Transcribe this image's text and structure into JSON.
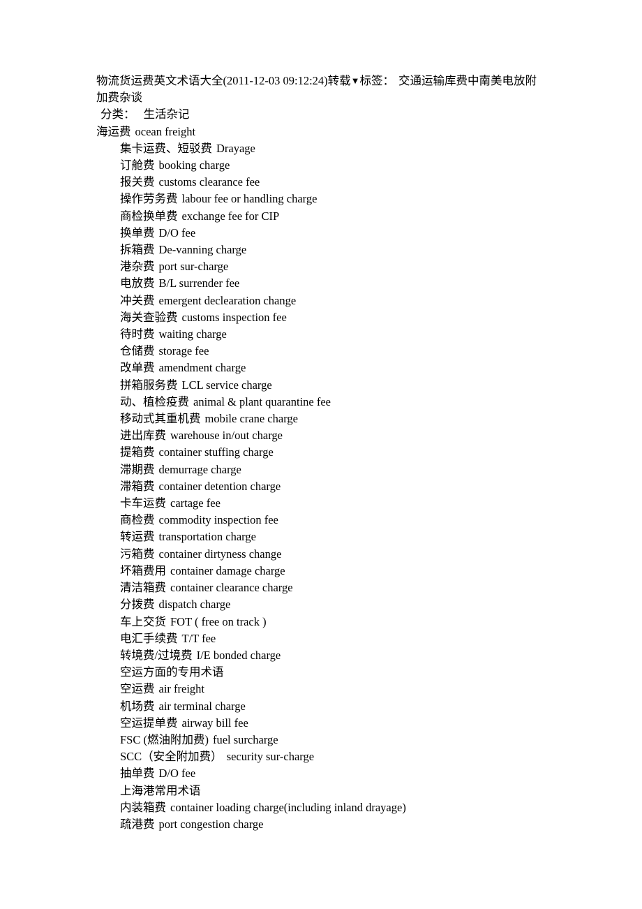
{
  "document": {
    "header": {
      "line1_title": "物流货运费英文术语大全",
      "line1_timestamp": "(2011-12-03 09:12:24)",
      "line1_repost": "转载",
      "line1_triangle": "▼",
      "line1_tags_label": "标签：",
      "line1_tags_value": "交通运输库费中南美电放附加费杂谈",
      "line2_category_label": "分类：",
      "line2_category_value": "生活杂记"
    },
    "root_entry": {
      "cn": "海运费",
      "en": "ocean freight"
    },
    "terms": [
      {
        "cn": "集卡运费、短驳费",
        "en": "Drayage"
      },
      {
        "cn": "订舱费",
        "en": "booking charge"
      },
      {
        "cn": "报关费",
        "en": "customs clearance fee"
      },
      {
        "cn": "操作劳务费",
        "en": "labour fee or handling charge"
      },
      {
        "cn": "商检换单费",
        "en": "exchange fee for CIP"
      },
      {
        "cn": "换单费",
        "en": "D/O fee"
      },
      {
        "cn": "拆箱费",
        "en": "De-vanning charge"
      },
      {
        "cn": "港杂费",
        "en": "port sur-charge"
      },
      {
        "cn": "电放费",
        "en": "B/L surrender fee"
      },
      {
        "cn": "冲关费",
        "en": "emergent declearation change"
      },
      {
        "cn": "海关查验费",
        "en": "customs inspection fee"
      },
      {
        "cn": "待时费",
        "en": "waiting charge"
      },
      {
        "cn": "仓储费",
        "en": "storage fee"
      },
      {
        "cn": "改单费",
        "en": "amendment charge"
      },
      {
        "cn": "拼箱服务费",
        "en": "LCL service charge"
      },
      {
        "cn": "动、植检疫费",
        "en": "animal & plant quarantine fee"
      },
      {
        "cn": "移动式其重机费",
        "en": "mobile crane charge"
      },
      {
        "cn": "进出库费",
        "en": "warehouse in/out charge"
      },
      {
        "cn": "提箱费",
        "en": "container stuffing charge"
      },
      {
        "cn": "滞期费",
        "en": "demurrage charge"
      },
      {
        "cn": "滞箱费",
        "en": "container detention charge"
      },
      {
        "cn": "卡车运费",
        "en": "cartage fee"
      },
      {
        "cn": "商检费",
        "en": "commodity inspection fee"
      },
      {
        "cn": "转运费",
        "en": "transportation charge"
      },
      {
        "cn": "污箱费",
        "en": "container dirtyness change"
      },
      {
        "cn": "坏箱费用",
        "en": "container damage charge"
      },
      {
        "cn": "清洁箱费",
        "en": "container clearance charge"
      },
      {
        "cn": "分拨费",
        "en": "dispatch charge"
      },
      {
        "cn": "车上交货",
        "en": "FOT ( free on track )"
      },
      {
        "cn": "电汇手续费",
        "en": "T/T fee"
      },
      {
        "cn": "转境费/过境费",
        "en": "I/E bonded charge"
      },
      {
        "cn": "空运方面的专用术语",
        "en": ""
      },
      {
        "cn": "空运费",
        "en": "air freight"
      },
      {
        "cn": "机场费",
        "en": "air terminal charge"
      },
      {
        "cn": "空运提单费",
        "en": "airway bill fee"
      },
      {
        "cn": "FSC (燃油附加费)",
        "en": "fuel surcharge"
      },
      {
        "cn": "SCC（安全附加费）",
        "en": "security sur-charge"
      },
      {
        "cn": "抽单费",
        "en": "D/O fee"
      },
      {
        "cn": "上海港常用术语",
        "en": ""
      },
      {
        "cn": "内装箱费",
        "en": "container loading charge(including inland drayage)"
      },
      {
        "cn": "疏港费",
        "en": "port congestion charge"
      }
    ]
  }
}
